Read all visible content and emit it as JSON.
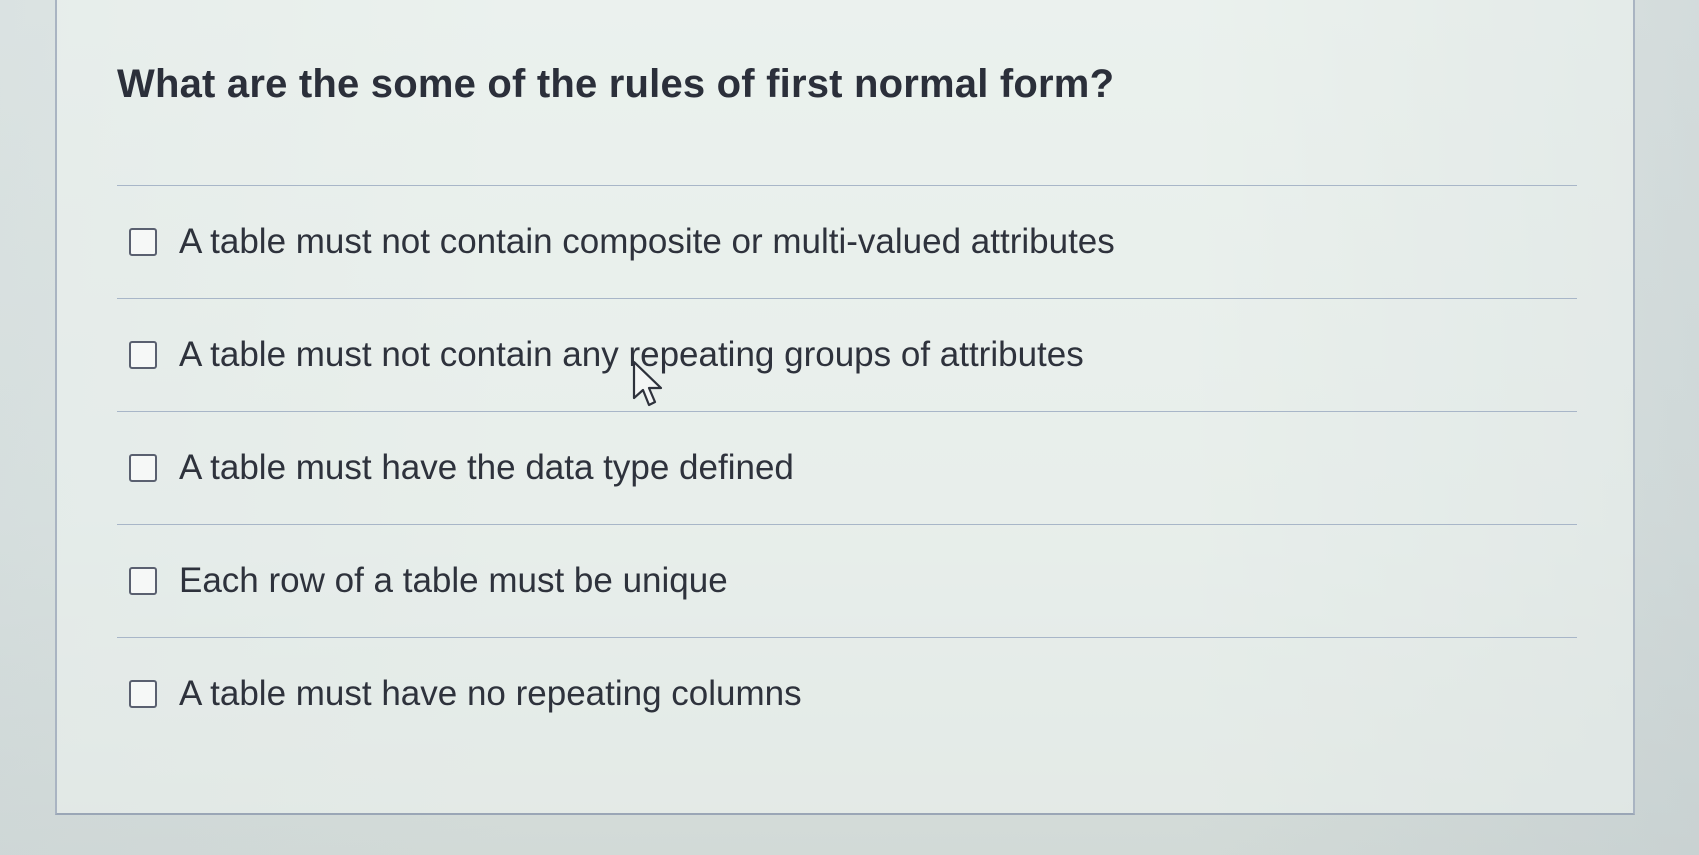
{
  "question": {
    "title": "What are the some of the rules of first normal form?"
  },
  "options": [
    {
      "label": "A table must not contain composite or multi-valued attributes",
      "checked": false
    },
    {
      "label": "A table must not contain any repeating groups of attributes",
      "checked": false
    },
    {
      "label": "A table must have the data type defined",
      "checked": false
    },
    {
      "label": "Each row of a table must be unique",
      "checked": false
    },
    {
      "label": "A table must have no repeating columns",
      "checked": false
    }
  ],
  "cursor": {
    "icon": "pointer-arrow-icon"
  },
  "colors": {
    "text": "#2e323c",
    "divider": "#a8b6c8",
    "checkbox_border": "#5a6070"
  }
}
